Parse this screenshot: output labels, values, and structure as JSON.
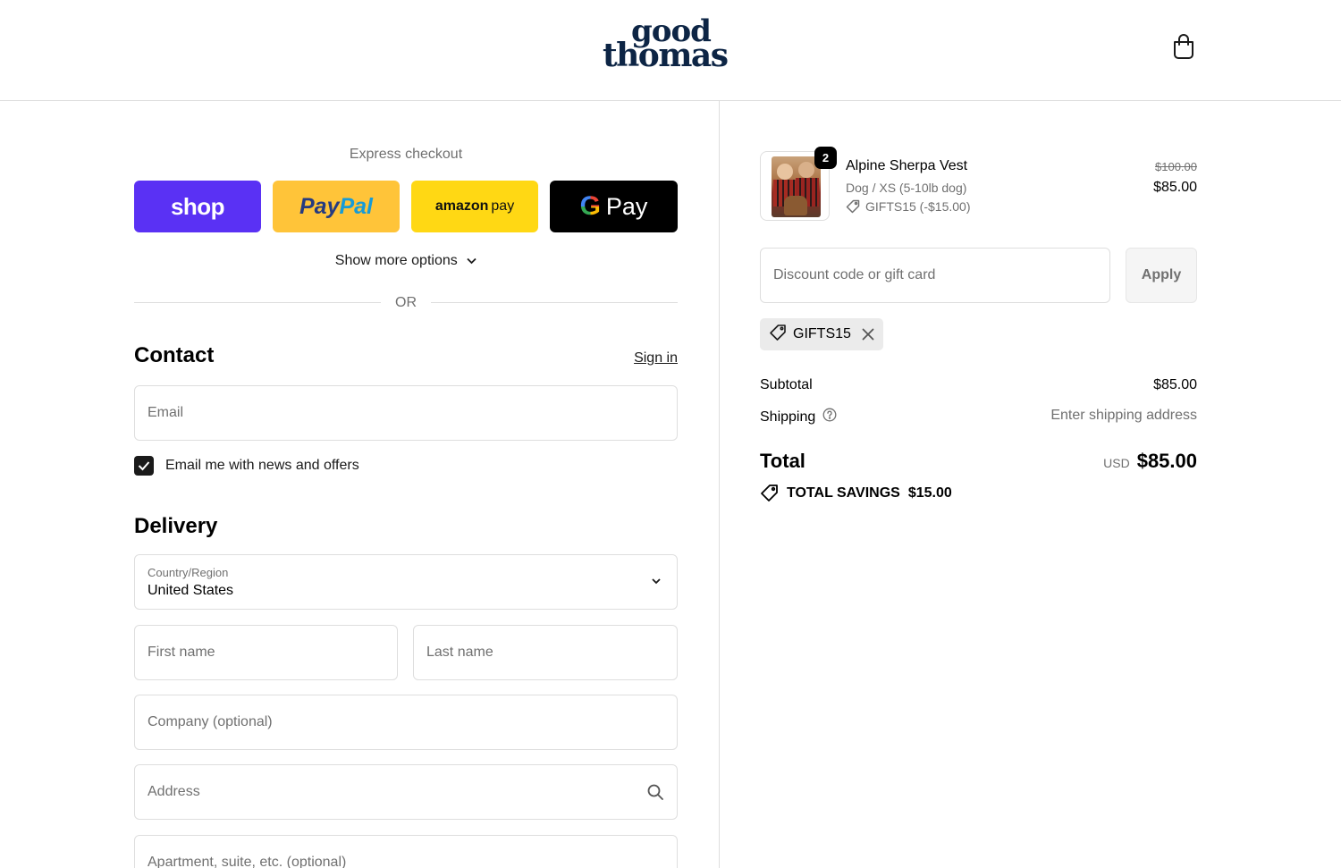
{
  "brand": {
    "logo_top": "good",
    "logo_bottom": "thomas",
    "cart_icon": "shopping-bag-icon"
  },
  "express": {
    "label": "Express checkout",
    "shop_label": "shop",
    "paypal_part1": "Pay",
    "paypal_part2": "Pal",
    "amazon_part1": "amazon",
    "amazon_part2": "pay",
    "gpay_g": "G",
    "gpay_label": "Pay",
    "show_more": "Show more options",
    "or_text": "OR"
  },
  "contact": {
    "title": "Contact",
    "sign_in": "Sign in",
    "email_placeholder": "Email",
    "newsletter_label": "Email me with news and offers",
    "newsletter_checked": true
  },
  "delivery": {
    "title": "Delivery",
    "country_label": "Country/Region",
    "country_value": "United States",
    "first_name_placeholder": "First name",
    "last_name_placeholder": "Last name",
    "company_placeholder": "Company (optional)",
    "address_placeholder": "Address",
    "apartment_placeholder": "Apartment, suite, etc. (optional)"
  },
  "order": {
    "item": {
      "quantity": "2",
      "name": "Alpine Sherpa Vest",
      "variant": "Dog / XS (5-10lb dog)",
      "discount_line": "GIFTS15 (-$15.00)",
      "original_price": "$100.00",
      "price": "$85.00"
    },
    "discount_placeholder": "Discount code or gift card",
    "apply_label": "Apply",
    "applied_code": "GIFTS15",
    "subtotal_label": "Subtotal",
    "subtotal_value": "$85.00",
    "shipping_label": "Shipping",
    "shipping_value": "Enter shipping address",
    "total_label": "Total",
    "total_currency": "USD",
    "total_value": "$85.00",
    "savings_label": "TOTAL SAVINGS",
    "savings_value": "$15.00"
  },
  "colors": {
    "shop": "#5a31f4",
    "paypal": "#ffc439",
    "amazon": "#ffd814",
    "gpay": "#000000",
    "brand_navy": "#0d2545"
  }
}
